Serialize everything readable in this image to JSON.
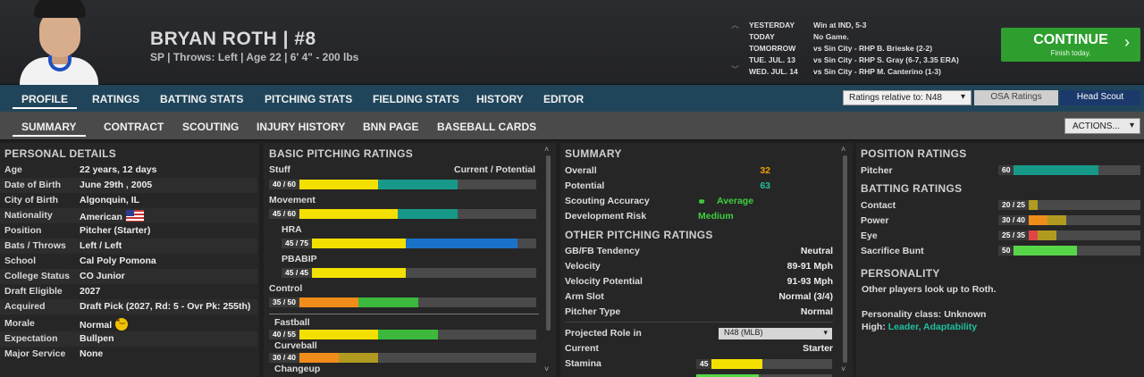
{
  "player": {
    "name": "BRYAN ROTH  |  #8",
    "info": "SP | Throws: Left  |  Age 22  |  6' 4\"  - 200 lbs"
  },
  "schedule": [
    {
      "day": "YESTERDAY",
      "desc": "Win at IND, 5-3"
    },
    {
      "day": "TODAY",
      "desc": "No Game."
    },
    {
      "day": "TOMORROW",
      "desc": "vs Sin City - RHP B. Brieske (2-2)"
    },
    {
      "day": "TUE. JUL. 13",
      "desc": "vs Sin City - RHP S. Gray (6-7, 3.35 ERA)"
    },
    {
      "day": "WED. JUL. 14",
      "desc": "vs Sin City - RHP M. Canterino (1-3)"
    }
  ],
  "continue": {
    "label": "CONTINUE",
    "sub": "Finish today."
  },
  "nav1": {
    "tabs": [
      "PROFILE",
      "RATINGS",
      "BATTING STATS",
      "PITCHING STATS",
      "FIELDING STATS",
      "HISTORY",
      "EDITOR"
    ],
    "ratings_relative": "Ratings relative to: N48",
    "osa": "OSA Ratings",
    "head_scout": "Head Scout"
  },
  "nav2": {
    "tabs": [
      "SUMMARY",
      "CONTRACT",
      "SCOUTING",
      "INJURY HISTORY",
      "BNN PAGE",
      "BASEBALL CARDS"
    ],
    "actions": "ACTIONS..."
  },
  "personal": {
    "title": "PERSONAL DETAILS",
    "rows": [
      {
        "k": "Age",
        "v": "22 years, 12 days"
      },
      {
        "k": "Date of Birth",
        "v": "June 29th , 2005"
      },
      {
        "k": "City of Birth",
        "v": "Algonquin, IL"
      },
      {
        "k": "Nationality",
        "v": "American"
      },
      {
        "k": "Position",
        "v": "Pitcher (Starter)"
      },
      {
        "k": "Bats / Throws",
        "v": "Left / Left"
      },
      {
        "k": "School",
        "v": "Cal Poly Pomona"
      },
      {
        "k": "College Status",
        "v": "CO Junior"
      },
      {
        "k": "Draft Eligible",
        "v": "2027"
      },
      {
        "k": "Acquired",
        "v": "Draft Pick (2027, Rd: 5 - Ovr Pk: 255th)"
      },
      {
        "k": "Morale",
        "v": "Normal"
      },
      {
        "k": "Expectation",
        "v": "Bullpen"
      },
      {
        "k": "Major Service",
        "v": "None"
      }
    ]
  },
  "pitching": {
    "title": "BASIC PITCHING RATINGS",
    "header": "Current / Potential",
    "stuff": {
      "label": "Stuff",
      "text": "40 / 60",
      "cur": 40,
      "pot": 60
    },
    "movement": {
      "label": "Movement",
      "text": "45 / 60",
      "cur": 45,
      "pot": 60
    },
    "hra": {
      "label": "HRA",
      "text": "45 / 75",
      "cur": 45,
      "pot": 75
    },
    "pbabip": {
      "label": "PBABIP",
      "text": "45 / 45",
      "cur": 45,
      "pot": 45
    },
    "control": {
      "label": "Control",
      "text": "35 / 50",
      "cur": 35,
      "pot": 50
    },
    "fastball": {
      "label": "Fastball",
      "text": "40 / 55",
      "cur": 40,
      "pot": 55
    },
    "curveball": {
      "label": "Curveball",
      "text": "30 / 40",
      "cur": 30,
      "pot": 40
    },
    "changeup": {
      "label": "Changeup"
    }
  },
  "summary": {
    "title": "SUMMARY",
    "overall": {
      "k": "Overall",
      "v": "32"
    },
    "potential": {
      "k": "Potential",
      "v": "63"
    },
    "scouting": {
      "k": "Scouting Accuracy",
      "v": "Average"
    },
    "devrisk": {
      "k": "Development Risk",
      "v": "Medium"
    },
    "other_title": "OTHER PITCHING RATINGS",
    "other": [
      {
        "k": "GB/FB Tendency",
        "v": "Neutral"
      },
      {
        "k": "Velocity",
        "v": "89-91 Mph"
      },
      {
        "k": "Velocity Potential",
        "v": "91-93 Mph"
      },
      {
        "k": "Arm Slot",
        "v": "Normal (3/4)"
      },
      {
        "k": "Pitcher Type",
        "v": "Normal"
      }
    ],
    "projected": {
      "k": "Projected Role in",
      "v": "N48 (MLB)"
    },
    "current": {
      "k": "Current",
      "v": "Starter"
    },
    "stamina": {
      "k": "Stamina",
      "text": "45",
      "value": 45
    }
  },
  "position": {
    "title": "POSITION RATINGS",
    "pitcher": {
      "k": "Pitcher",
      "text": "60",
      "value": 60
    },
    "batting_title": "BATTING RATINGS",
    "batting": [
      {
        "k": "Contact",
        "text": "20 / 25",
        "cur": 20,
        "pot": 25
      },
      {
        "k": "Power",
        "text": "30 / 40",
        "cur": 30,
        "pot": 40
      },
      {
        "k": "Eye",
        "text": "25 / 35",
        "cur": 25,
        "pot": 35
      },
      {
        "k": "Sacrifice Bunt",
        "text": "50",
        "value": 50
      }
    ],
    "personality_title": "PERSONALITY",
    "personality_text": "Other players look up to Roth.",
    "personality_class": "Personality class: Unknown",
    "high_label": "High:",
    "high_value": "Leader, Adaptability"
  },
  "colors": {
    "continue": "#2e9f2e",
    "nav1": "#20455a",
    "overall": "#f0a000",
    "potential": "#20c0a0",
    "average": "#3ecf3e",
    "medium": "#3ecf3e"
  }
}
